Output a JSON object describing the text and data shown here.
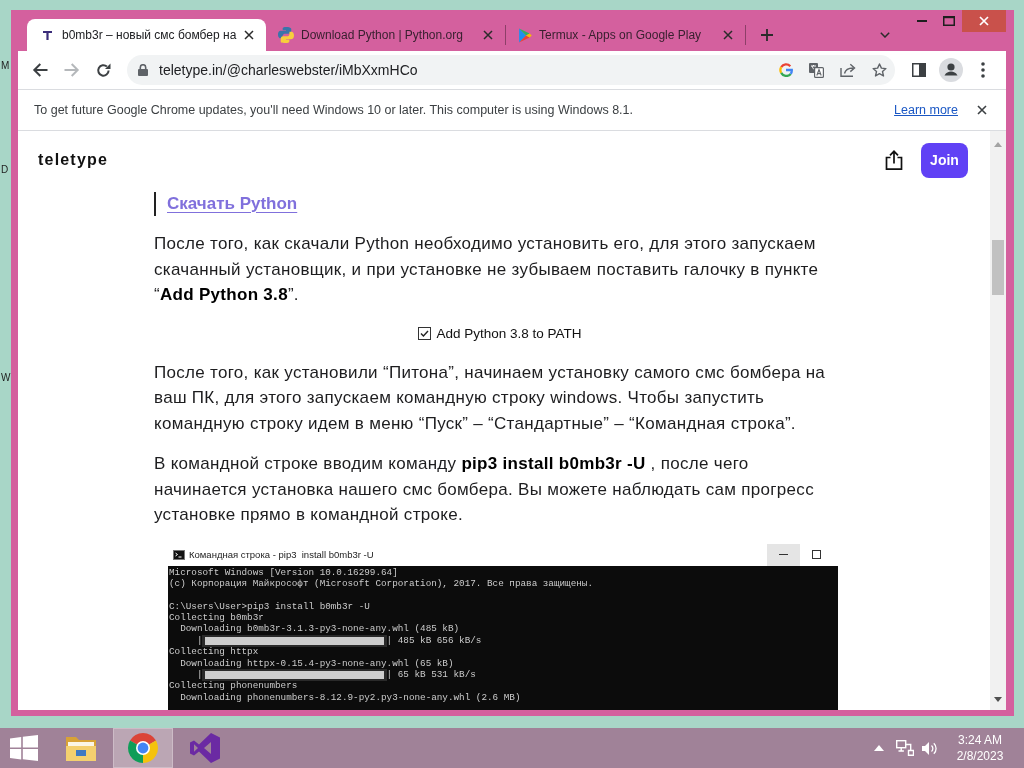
{
  "desktop": {
    "icon_labels": [
      "M",
      "D",
      "W"
    ]
  },
  "browser": {
    "tabs": [
      {
        "kind": "teletype",
        "title": "b0mb3r – новый смс бомбер на",
        "selected": true
      },
      {
        "kind": "python",
        "title": "Download Python | Python.org",
        "selected": false
      },
      {
        "kind": "play",
        "title": "Termux - Apps on Google Play",
        "selected": false
      }
    ],
    "navigation": {
      "back": {
        "disabled": false
      },
      "forward": {
        "disabled": true
      }
    },
    "url": "teletype.in/@charleswebster/iMbXxmHCo",
    "infobar": {
      "message": "To get future Google Chrome updates, you'll need Windows 10 or later. This computer is using Windows 8.1.",
      "link": "Learn more"
    }
  },
  "page": {
    "logo": "teletype",
    "join_button": "Join",
    "blocks": [
      {
        "kind": "link",
        "text": "Скачать Python"
      },
      {
        "kind": "paragraph",
        "text": "После того, как скачали Python необходимо установить его, для этого запускаем скачанный установщик, и при установке не зубываем поставить галочку в пункте “**Add Python 3.8**”."
      },
      {
        "kind": "checkbox_image",
        "label": "Add Python 3.8 to PATH",
        "checked": true
      },
      {
        "kind": "paragraph",
        "text": "После того, как установили “Питона”, начинаем установку самого смс бомбера на ваш ПК, для этого запускаем командную строку windows. Чтобы запустить командную строку идем в меню “Пуск” – “Стандартные” – “Командная строка”."
      },
      {
        "kind": "paragraph",
        "text": "В командной строке вводим команду **pip3 install b0mb3r -U** , после чего начинается установка нашего смс бомбера. Вы можете наблюдать сам прогресс установке прямо в командной строке."
      },
      {
        "kind": "console_image",
        "title": "Командная строка - pip3  install b0mb3r -U",
        "lines": [
          {
            "kind": "text",
            "text": "Microsoft Windows [Version 10.0.16299.64]"
          },
          {
            "kind": "text",
            "text": "(c) Корпорация Майкрософт (Microsoft Corporation), 2017. Все права защищены."
          },
          {
            "kind": "blank"
          },
          {
            "kind": "text",
            "text": "C:\\Users\\User>pip3 install b0mb3r -U"
          },
          {
            "kind": "text",
            "text": "Collecting b0mb3r"
          },
          {
            "kind": "text",
            "text": "  Downloading b0mb3r-3.1.3-py3-none-any.whl (485 kB)"
          },
          {
            "kind": "progress",
            "bar_start": "|",
            "level": 1,
            "reading": "| 485 kB 656 kB/s"
          },
          {
            "kind": "text",
            "text": "Collecting httpx"
          },
          {
            "kind": "text",
            "text": "  Downloading httpx-0.15.4-py3-none-any.whl (65 kB)"
          },
          {
            "kind": "progress",
            "bar_start": "|",
            "level": 1,
            "reading": "| 65 kB 531 kB/s"
          },
          {
            "kind": "text",
            "text": "Collecting phonenumbers"
          },
          {
            "kind": "text",
            "text": "  Downloading phonenumbers-8.12.9-py2.py3-none-any.whl (2.6 MB)"
          }
        ]
      }
    ]
  },
  "taskbar": {
    "apps": [
      {
        "kind": "explorer",
        "selected": false
      },
      {
        "kind": "chrome",
        "selected": true
      },
      {
        "kind": "visual_studio",
        "selected": false
      }
    ],
    "time": "3:24 AM",
    "date": "2/8/2023"
  }
}
